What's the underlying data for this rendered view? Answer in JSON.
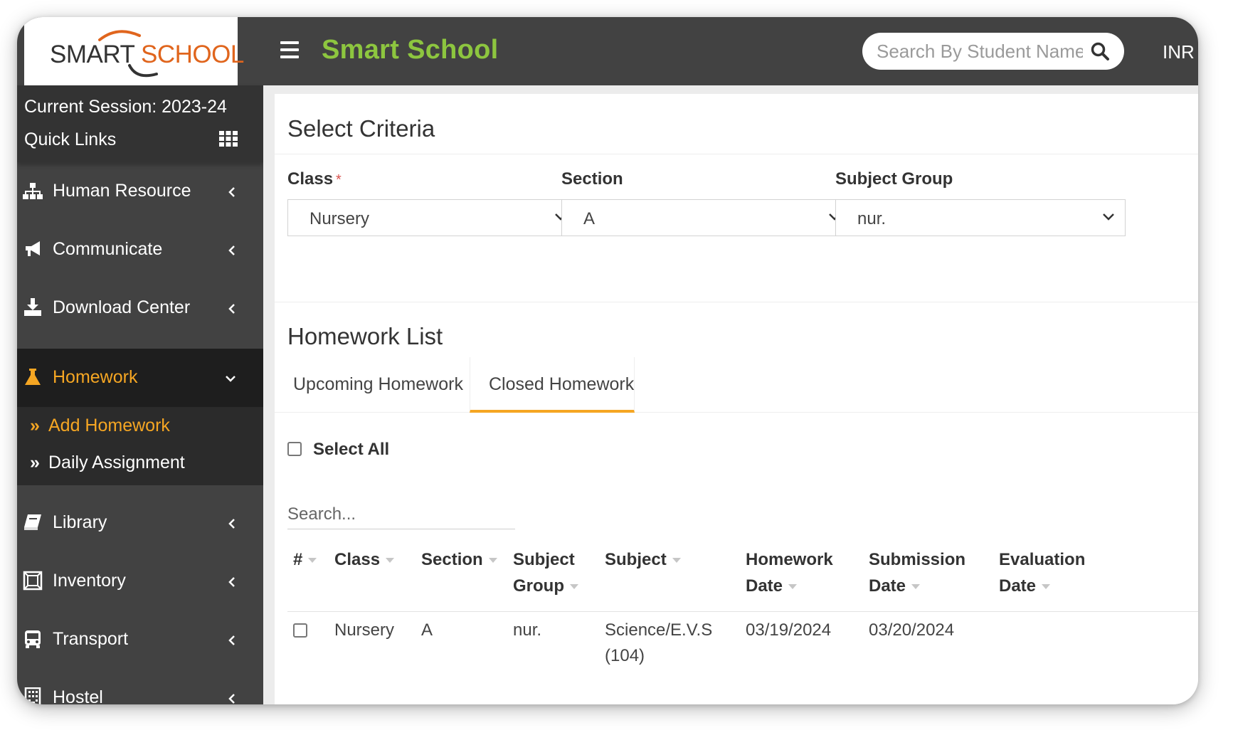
{
  "header": {
    "logo_smart": "SMART",
    "logo_school": "SCHOOL",
    "app_title": "Smart School",
    "search_placeholder": "Search By Student Name",
    "currency": "INR"
  },
  "sidebar": {
    "session": "Current Session: 2023-24",
    "quick_links": "Quick Links",
    "items": [
      {
        "label": "Human Resource",
        "icon": "sitemap-icon"
      },
      {
        "label": "Communicate",
        "icon": "bullhorn-icon"
      },
      {
        "label": "Download Center",
        "icon": "download-icon"
      },
      {
        "label": "Homework",
        "icon": "flask-icon",
        "active": true
      },
      {
        "label": "Library",
        "icon": "book-icon"
      },
      {
        "label": "Inventory",
        "icon": "inventory-icon"
      },
      {
        "label": "Transport",
        "icon": "bus-icon"
      },
      {
        "label": "Hostel",
        "icon": "building-icon"
      }
    ],
    "homework_submenu": [
      {
        "label": "Add Homework",
        "active": true
      },
      {
        "label": "Daily Assignment"
      }
    ]
  },
  "criteria": {
    "title": "Select Criteria",
    "class_label": "Class",
    "class_required": "*",
    "class_value": "Nursery",
    "section_label": "Section",
    "section_value": "A",
    "subject_group_label": "Subject Group",
    "subject_group_value": "nur."
  },
  "homework_list": {
    "title": "Homework List",
    "tabs": [
      {
        "label": "Upcoming Homework"
      },
      {
        "label": "Closed Homework",
        "active": true
      }
    ],
    "select_all": "Select All",
    "search_placeholder": "Search...",
    "columns": [
      {
        "line1": "#",
        "line2": ""
      },
      {
        "line1": "Class",
        "line2": ""
      },
      {
        "line1": "Section",
        "line2": ""
      },
      {
        "line1": "Subject",
        "line2": "Group"
      },
      {
        "line1": "Subject",
        "line2": ""
      },
      {
        "line1": "Homework",
        "line2": "Date"
      },
      {
        "line1": "Submission",
        "line2": "Date"
      },
      {
        "line1": "Evaluation",
        "line2": "Date"
      }
    ],
    "rows": [
      {
        "class": "Nursery",
        "section": "A",
        "subject_group": "nur.",
        "subject_line1": "Science/E.V.S",
        "subject_line2": "(104)",
        "homework_date": "03/19/2024",
        "submission_date": "03/20/2024",
        "evaluation_date": ""
      }
    ]
  },
  "colors": {
    "header_bg": "#424242",
    "brand_green": "#8dc63f",
    "accent_orange": "#f5a623",
    "logo_orange": "#e0651d"
  }
}
